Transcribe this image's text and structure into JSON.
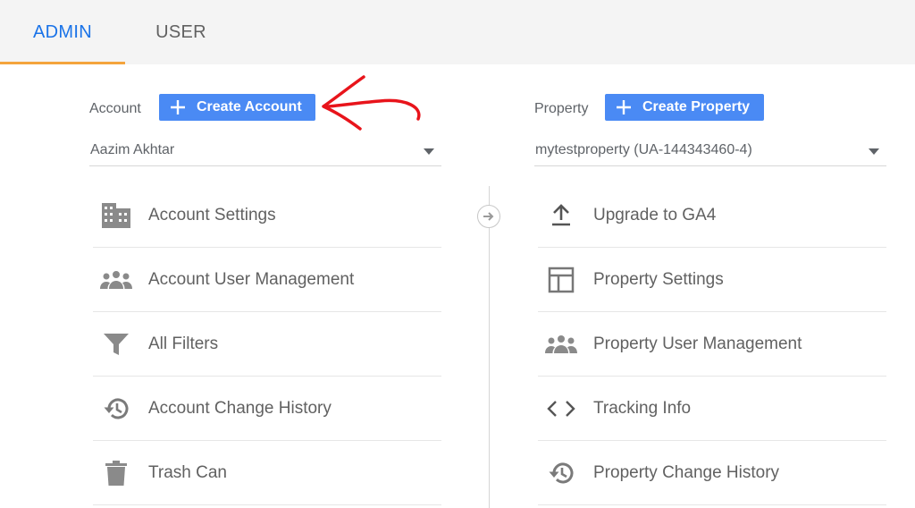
{
  "tabs": {
    "admin": "ADMIN",
    "user": "USER"
  },
  "account": {
    "header_label": "Account",
    "create_button": "Create Account",
    "selected": "Aazim Akhtar",
    "menu": [
      {
        "label": "Account Settings",
        "icon": "building-icon"
      },
      {
        "label": "Account User Management",
        "icon": "people-icon"
      },
      {
        "label": "All Filters",
        "icon": "filter-icon"
      },
      {
        "label": "Account Change History",
        "icon": "history-icon"
      },
      {
        "label": "Trash Can",
        "icon": "trash-icon"
      }
    ]
  },
  "property": {
    "header_label": "Property",
    "create_button": "Create Property",
    "selected": "mytestproperty (UA-144343460-4)",
    "menu": [
      {
        "label": "Upgrade to GA4",
        "icon": "upload-icon"
      },
      {
        "label": "Property Settings",
        "icon": "layout-icon"
      },
      {
        "label": "Property User Management",
        "icon": "people-icon"
      },
      {
        "label": "Tracking Info",
        "icon": "code-icon"
      },
      {
        "label": "Property Change History",
        "icon": "history-icon"
      }
    ]
  },
  "colors": {
    "accent_blue": "#1a73e8",
    "button_blue": "#4a8af4",
    "tab_underline": "#f4a43c",
    "annotation_red": "#e8141b"
  }
}
